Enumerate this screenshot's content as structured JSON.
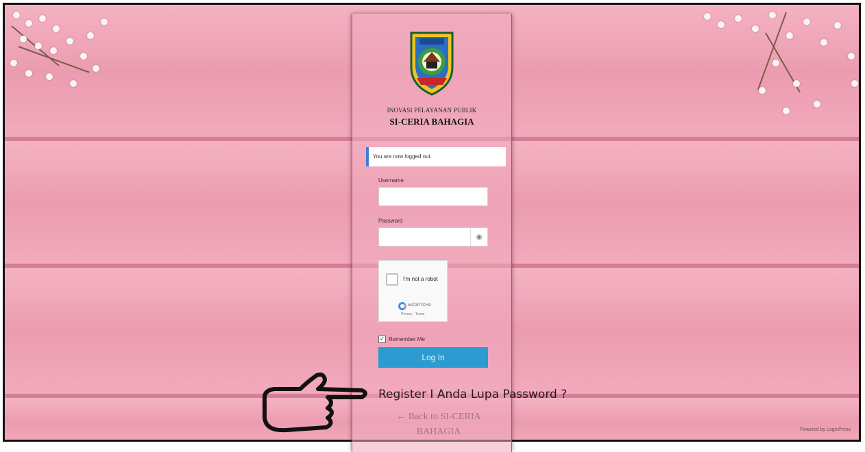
{
  "login": {
    "subtitle": "INOVASI PELAYANAN PUBLIK",
    "title": "SI-CERIA BAHAGIA",
    "notice": "You are now logged out.",
    "username_label": "Username",
    "username_value": "",
    "password_label": "Password",
    "password_value": "",
    "captcha_label": "I'm not a robot",
    "captcha_brand": "reCAPTCHA",
    "captcha_links": "Privacy - Terms",
    "remember_label": "Remember Me",
    "remember_checked": true,
    "login_button": "Log In",
    "register_link": "Register I Anda Lupa Password ?",
    "back_link": "← Back to SI-CERIA BAHAGIA",
    "powered_by": "Powered by LoginPress"
  },
  "colors": {
    "background": "#ef9fb3",
    "login_button": "#2c9bd1",
    "notice_border": "#3b7dd8"
  },
  "icons": [
    "logo-emblem",
    "eye-icon",
    "recaptcha-icon",
    "pointing-hand-icon",
    "checkbox-icon"
  ]
}
